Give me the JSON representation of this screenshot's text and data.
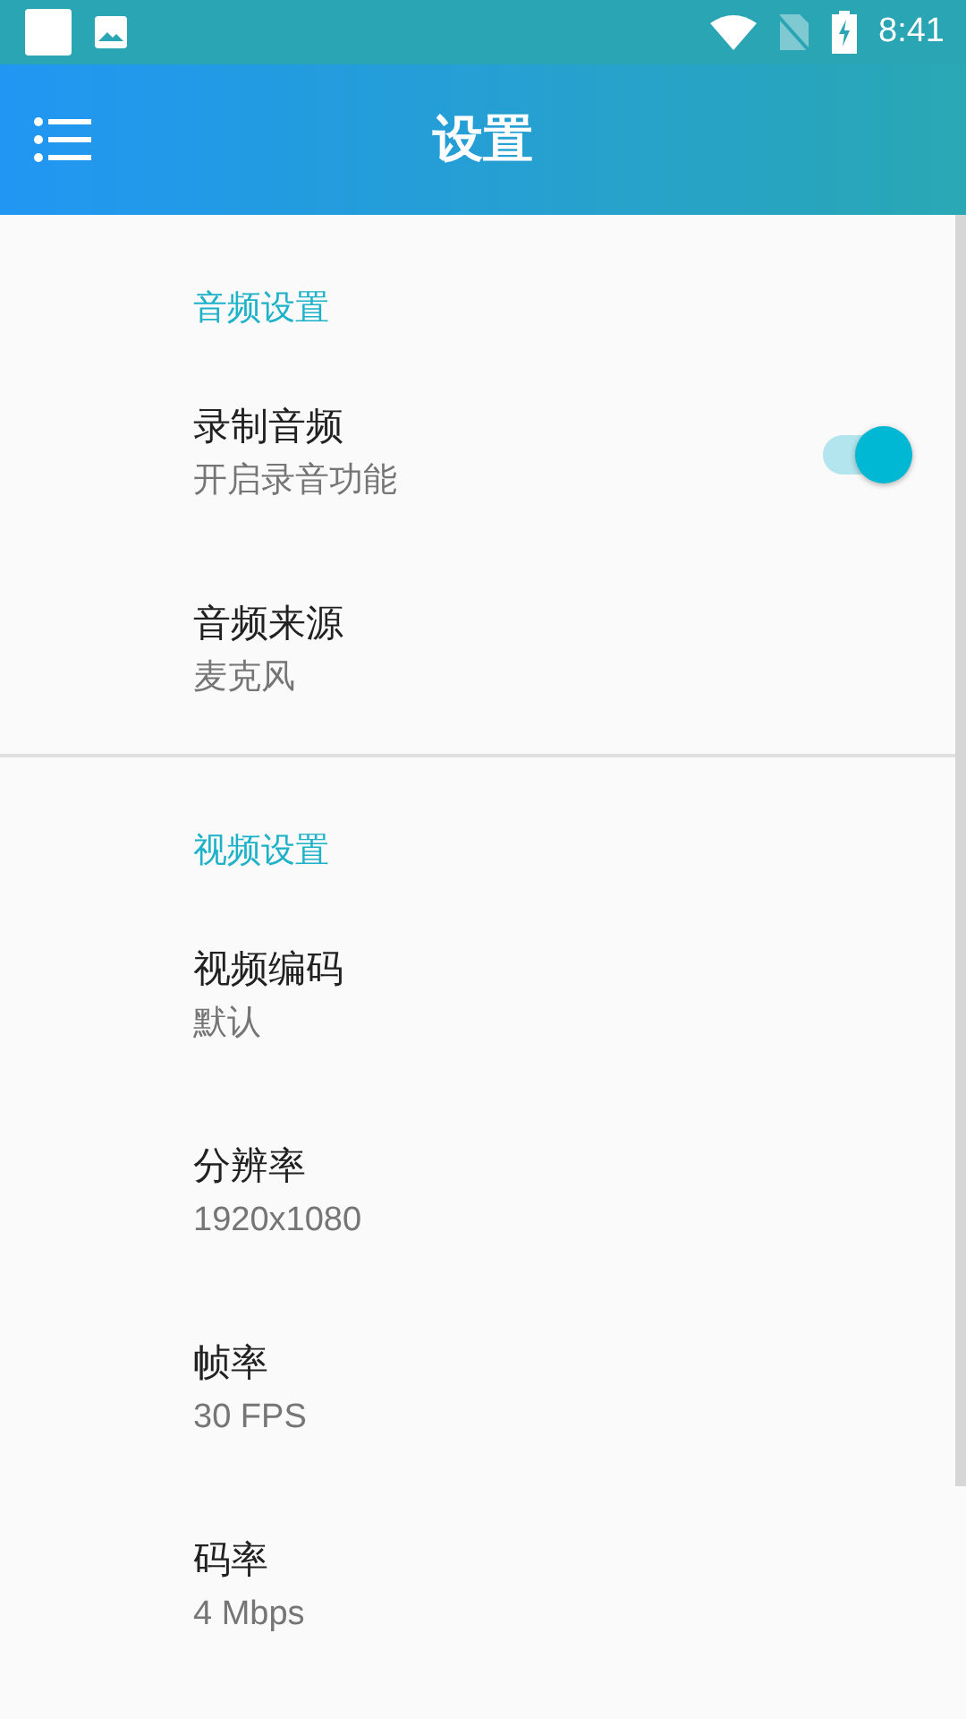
{
  "status_bar": {
    "time": "8:41"
  },
  "app_bar": {
    "title": "设置"
  },
  "sections": [
    {
      "title": "音频设置",
      "items": [
        {
          "kind": "switch",
          "title": "录制音频",
          "summary": "开启录音功能",
          "on": true
        },
        {
          "kind": "plain",
          "title": "音频来源",
          "summary": "麦克风"
        }
      ]
    },
    {
      "title": "视频设置",
      "items": [
        {
          "kind": "plain",
          "title": "视频编码",
          "summary": "默认"
        },
        {
          "kind": "plain",
          "title": "分辨率",
          "summary": "1920x1080"
        },
        {
          "kind": "plain",
          "title": "帧率",
          "summary": "30 FPS"
        },
        {
          "kind": "plain",
          "title": "码率",
          "summary": "4 Mbps"
        }
      ]
    }
  ]
}
